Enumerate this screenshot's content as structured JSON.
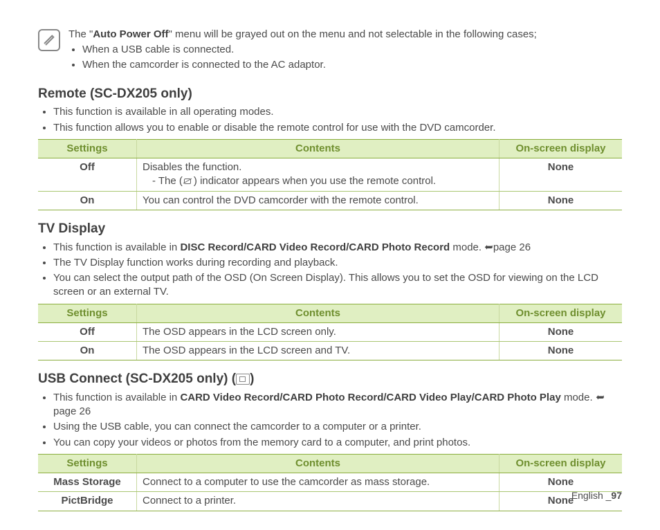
{
  "note": {
    "line1_prefix": "The \"",
    "line1_bold": "Auto Power Off",
    "line1_suffix": "\" menu will be grayed out on the menu and not selectable in the following cases;",
    "bullets": [
      "When a USB cable is connected.",
      "When the camcorder is connected to the AC adaptor."
    ]
  },
  "remote": {
    "title": "Remote (SC-DX205 only)",
    "bullets": [
      "This function is available in all operating modes.",
      "This function allows you to enable or disable the remote control for use with the DVD camcorder."
    ],
    "table": {
      "headers": [
        "Settings",
        "Contents",
        "On-screen display"
      ],
      "rows": [
        {
          "setting": "Off",
          "contents_line1": "Disables the function.",
          "contents_line2_prefix": "-   The (",
          "contents_line2_suffix": ") indicator appears when you use the remote control.",
          "osd": "None"
        },
        {
          "setting": "On",
          "contents": "You can control the DVD camcorder with the remote control.",
          "osd": "None"
        }
      ]
    }
  },
  "tv": {
    "title": "TV Display",
    "bullet1_prefix": "This function is available in ",
    "bullet1_bold": "DISC Record/CARD Video Record/CARD Photo Record",
    "bullet1_suffix": " mode. ",
    "bullet1_page": "page 26",
    "bullets_rest": [
      "The TV Display function works during recording and playback.",
      "You can select the output path of the OSD (On Screen Display). This allows you to set the OSD for viewing on the LCD screen or an external TV."
    ],
    "table": {
      "headers": [
        "Settings",
        "Contents",
        "On-screen display"
      ],
      "rows": [
        {
          "setting": "Off",
          "contents": "The OSD appears in the LCD screen only.",
          "osd": "None"
        },
        {
          "setting": "On",
          "contents": "The OSD appears in the LCD screen and TV.",
          "osd": "None"
        }
      ]
    }
  },
  "usb": {
    "title_prefix": "USB Connect (SC-DX205 only) (",
    "title_suffix": ")",
    "bullet1_prefix": "This function is available in ",
    "bullet1_bold": "CARD Video Record/CARD Photo Record/CARD Video Play/CARD Photo Play",
    "bullet1_suffix": " mode. ",
    "bullet1_page": "page 26",
    "bullets_rest": [
      "Using the USB cable, you can connect the camcorder to a computer or a printer.",
      "You can copy your videos or photos from the memory card to a computer, and print photos."
    ],
    "table": {
      "headers": [
        "Settings",
        "Contents",
        "On-screen display"
      ],
      "rows": [
        {
          "setting": "Mass Storage",
          "contents": "Connect to a computer to use the camcorder as mass storage.",
          "osd": "None"
        },
        {
          "setting": "PictBridge",
          "contents": "Connect to a printer.",
          "osd": "None"
        }
      ]
    }
  },
  "footer": {
    "lang": "English",
    "sep": " _",
    "page": "97"
  }
}
